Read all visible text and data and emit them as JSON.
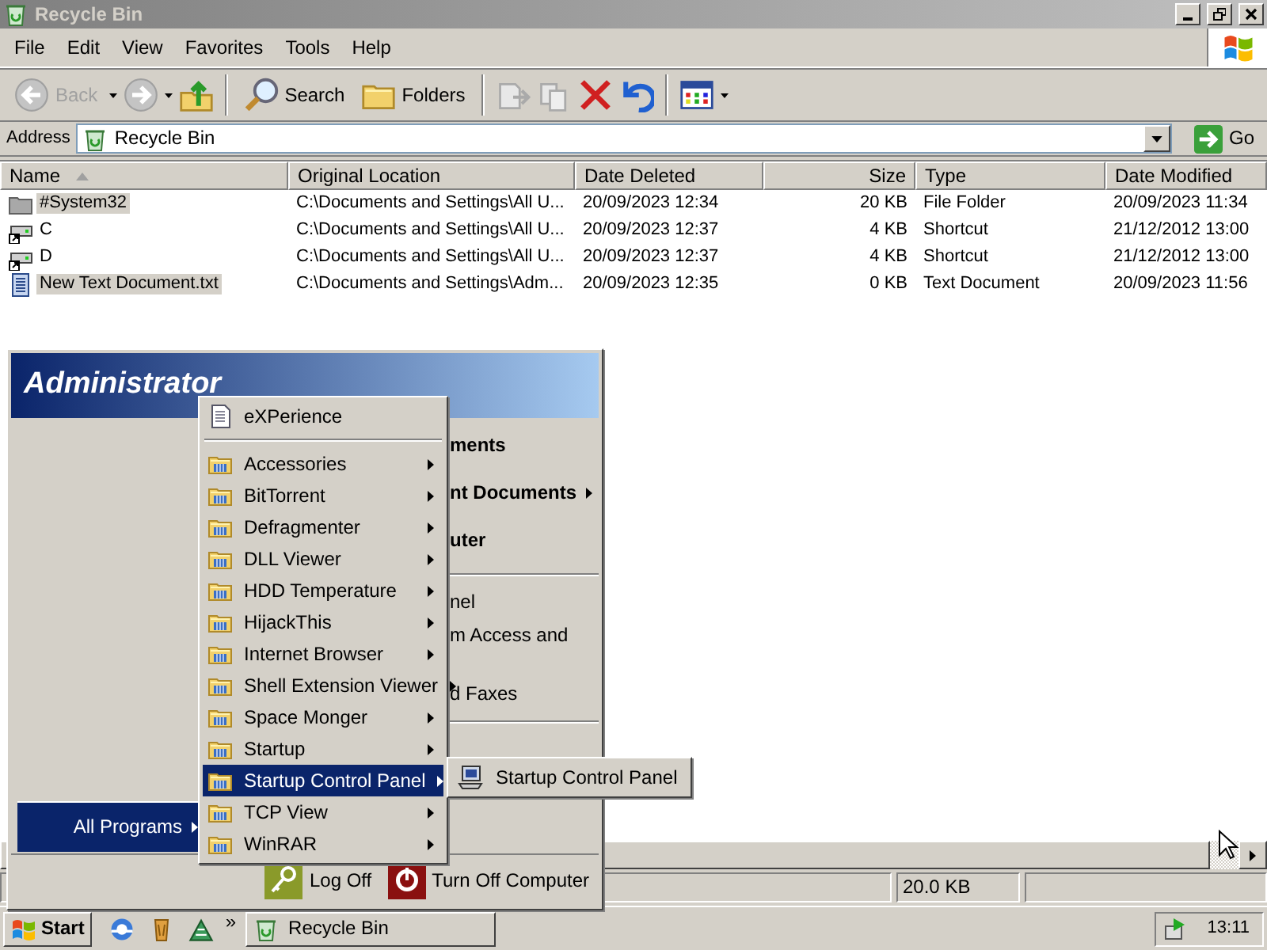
{
  "window": {
    "title": "Recycle Bin"
  },
  "menu_bar": [
    "File",
    "Edit",
    "View",
    "Favorites",
    "Tools",
    "Help"
  ],
  "toolbar": [
    {
      "kind": "back",
      "label": "Back",
      "disabled": true
    },
    {
      "kind": "forward",
      "disabled": true
    },
    {
      "kind": "up",
      "disabled": false
    },
    {
      "kind": "separator"
    },
    {
      "kind": "search",
      "label": "Search",
      "disabled": false
    },
    {
      "kind": "folders",
      "label": "Folders",
      "disabled": false
    },
    {
      "kind": "separator"
    },
    {
      "kind": "move",
      "disabled": true
    },
    {
      "kind": "copy",
      "disabled": true
    },
    {
      "kind": "delete",
      "disabled": false
    },
    {
      "kind": "undo",
      "disabled": false
    },
    {
      "kind": "separator"
    },
    {
      "kind": "views",
      "disabled": false
    }
  ],
  "address_bar": {
    "label": "Address",
    "value": "Recycle Bin",
    "go": "Go"
  },
  "file_list": {
    "columns": [
      {
        "label": "Name",
        "sorted": true
      },
      {
        "label": "Original Location",
        "sorted": false
      },
      {
        "label": "Date Deleted",
        "sorted": false
      },
      {
        "label": "Size",
        "sorted": false
      },
      {
        "label": "Type",
        "sorted": false
      },
      {
        "label": "Date Modified",
        "sorted": false
      }
    ],
    "rows": [
      {
        "kind": "folder",
        "name": "#System32",
        "original_location": "C:\\Documents and Settings\\All U...",
        "date_deleted": "20/09/2023 12:34",
        "size": "20 KB",
        "type": "File Folder",
        "date_modified": "20/09/2023 11:34",
        "selected": true
      },
      {
        "kind": "shortcut",
        "name": "C",
        "original_location": "C:\\Documents and Settings\\All U...",
        "date_deleted": "20/09/2023 12:37",
        "size": "4 KB",
        "type": "Shortcut",
        "date_modified": "21/12/2012 13:00",
        "selected": false
      },
      {
        "kind": "shortcut",
        "name": "D",
        "original_location": "C:\\Documents and Settings\\All U...",
        "date_deleted": "20/09/2023 12:37",
        "size": "4 KB",
        "type": "Shortcut",
        "date_modified": "21/12/2012 13:00",
        "selected": false
      },
      {
        "kind": "text",
        "name": "New Text Document.txt",
        "original_location": "C:\\Documents and Settings\\Adm...",
        "date_deleted": "20/09/2023 12:35",
        "size": "0 KB",
        "type": "Text Document",
        "date_modified": "20/09/2023 11:56",
        "selected": true
      }
    ]
  },
  "status_bar": {
    "size": "20.0 KB"
  },
  "start_menu": {
    "user": "Administrator",
    "right_items": [
      {
        "kind": "major",
        "label": "ments",
        "submenu": false
      },
      {
        "kind": "major",
        "label": "nt Documents",
        "submenu": true
      },
      {
        "kind": "major",
        "label": "uter",
        "submenu": false
      },
      {
        "kind": "separator"
      },
      {
        "kind": "minor",
        "label": "nel",
        "submenu": false
      },
      {
        "kind": "minor_tall",
        "label": "m Access and",
        "submenu": false
      },
      {
        "kind": "minor",
        "label": "d Faxes",
        "submenu": false
      },
      {
        "kind": "separator"
      }
    ],
    "all_programs": {
      "label": "All Programs",
      "selected": true
    },
    "programs": [
      {
        "kind": "program",
        "label": "eXPerience",
        "selected": false
      },
      {
        "kind": "separator"
      },
      {
        "kind": "folder",
        "label": "Accessories",
        "selected": false
      },
      {
        "kind": "folder",
        "label": "BitTorrent",
        "selected": false
      },
      {
        "kind": "folder",
        "label": "Defragmenter",
        "selected": false
      },
      {
        "kind": "folder",
        "label": "DLL Viewer",
        "selected": false
      },
      {
        "kind": "folder",
        "label": "HDD Temperature",
        "selected": false
      },
      {
        "kind": "folder",
        "label": "HijackThis",
        "selected": false
      },
      {
        "kind": "folder",
        "label": "Internet Browser",
        "selected": false
      },
      {
        "kind": "folder",
        "label": "Shell Extension Viewer",
        "selected": false
      },
      {
        "kind": "folder",
        "label": "Space Monger",
        "selected": false
      },
      {
        "kind": "folder",
        "label": "Startup",
        "selected": false
      },
      {
        "kind": "folder",
        "label": "Startup Control Panel",
        "selected": true
      },
      {
        "kind": "folder",
        "label": "TCP View",
        "selected": false
      },
      {
        "kind": "folder",
        "label": "WinRAR",
        "selected": false
      }
    ],
    "flyout": [
      {
        "label": "Startup Control Panel"
      }
    ],
    "log_off": "Log Off",
    "turn_off": "Turn Off Computer"
  },
  "taskbar": {
    "start": "Start",
    "chevron": "»",
    "tasks": [
      {
        "label": "Recycle Bin"
      }
    ],
    "clock": "13:11"
  }
}
